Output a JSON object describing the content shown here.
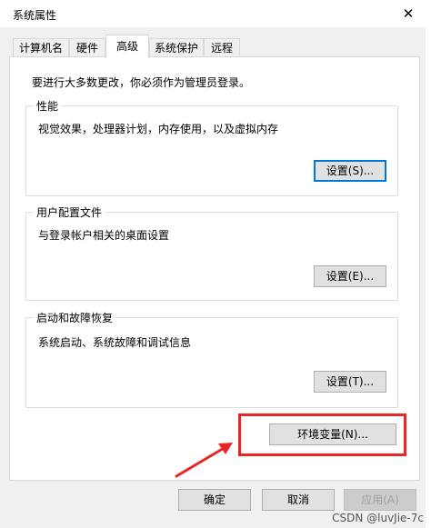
{
  "window": {
    "title": "系统属性",
    "close_glyph": "✕"
  },
  "tabs": [
    {
      "label": "计算机名"
    },
    {
      "label": "硬件"
    },
    {
      "label": "高级",
      "active": true
    },
    {
      "label": "系统保护"
    },
    {
      "label": "远程"
    }
  ],
  "admin_note": "要进行大多数更改，你必须作为管理员登录。",
  "groups": {
    "performance": {
      "title": "性能",
      "desc": "视觉效果，处理器计划，内存使用，以及虚拟内存",
      "button": "设置(S)..."
    },
    "profiles": {
      "title": "用户配置文件",
      "desc": "与登录帐户相关的桌面设置",
      "button": "设置(E)..."
    },
    "startup": {
      "title": "启动和故障恢复",
      "desc": "系统启动、系统故障和调试信息",
      "button": "设置(T)..."
    }
  },
  "env_button": "环境变量(N)...",
  "footer": {
    "ok": "确定",
    "cancel": "取消",
    "apply": "应用(A)"
  },
  "watermark": "CSDN @luvJie-7c",
  "colors": {
    "highlight": "#e8262a",
    "focus": "#0078d7",
    "panel_bg": "#f0f0f0"
  }
}
